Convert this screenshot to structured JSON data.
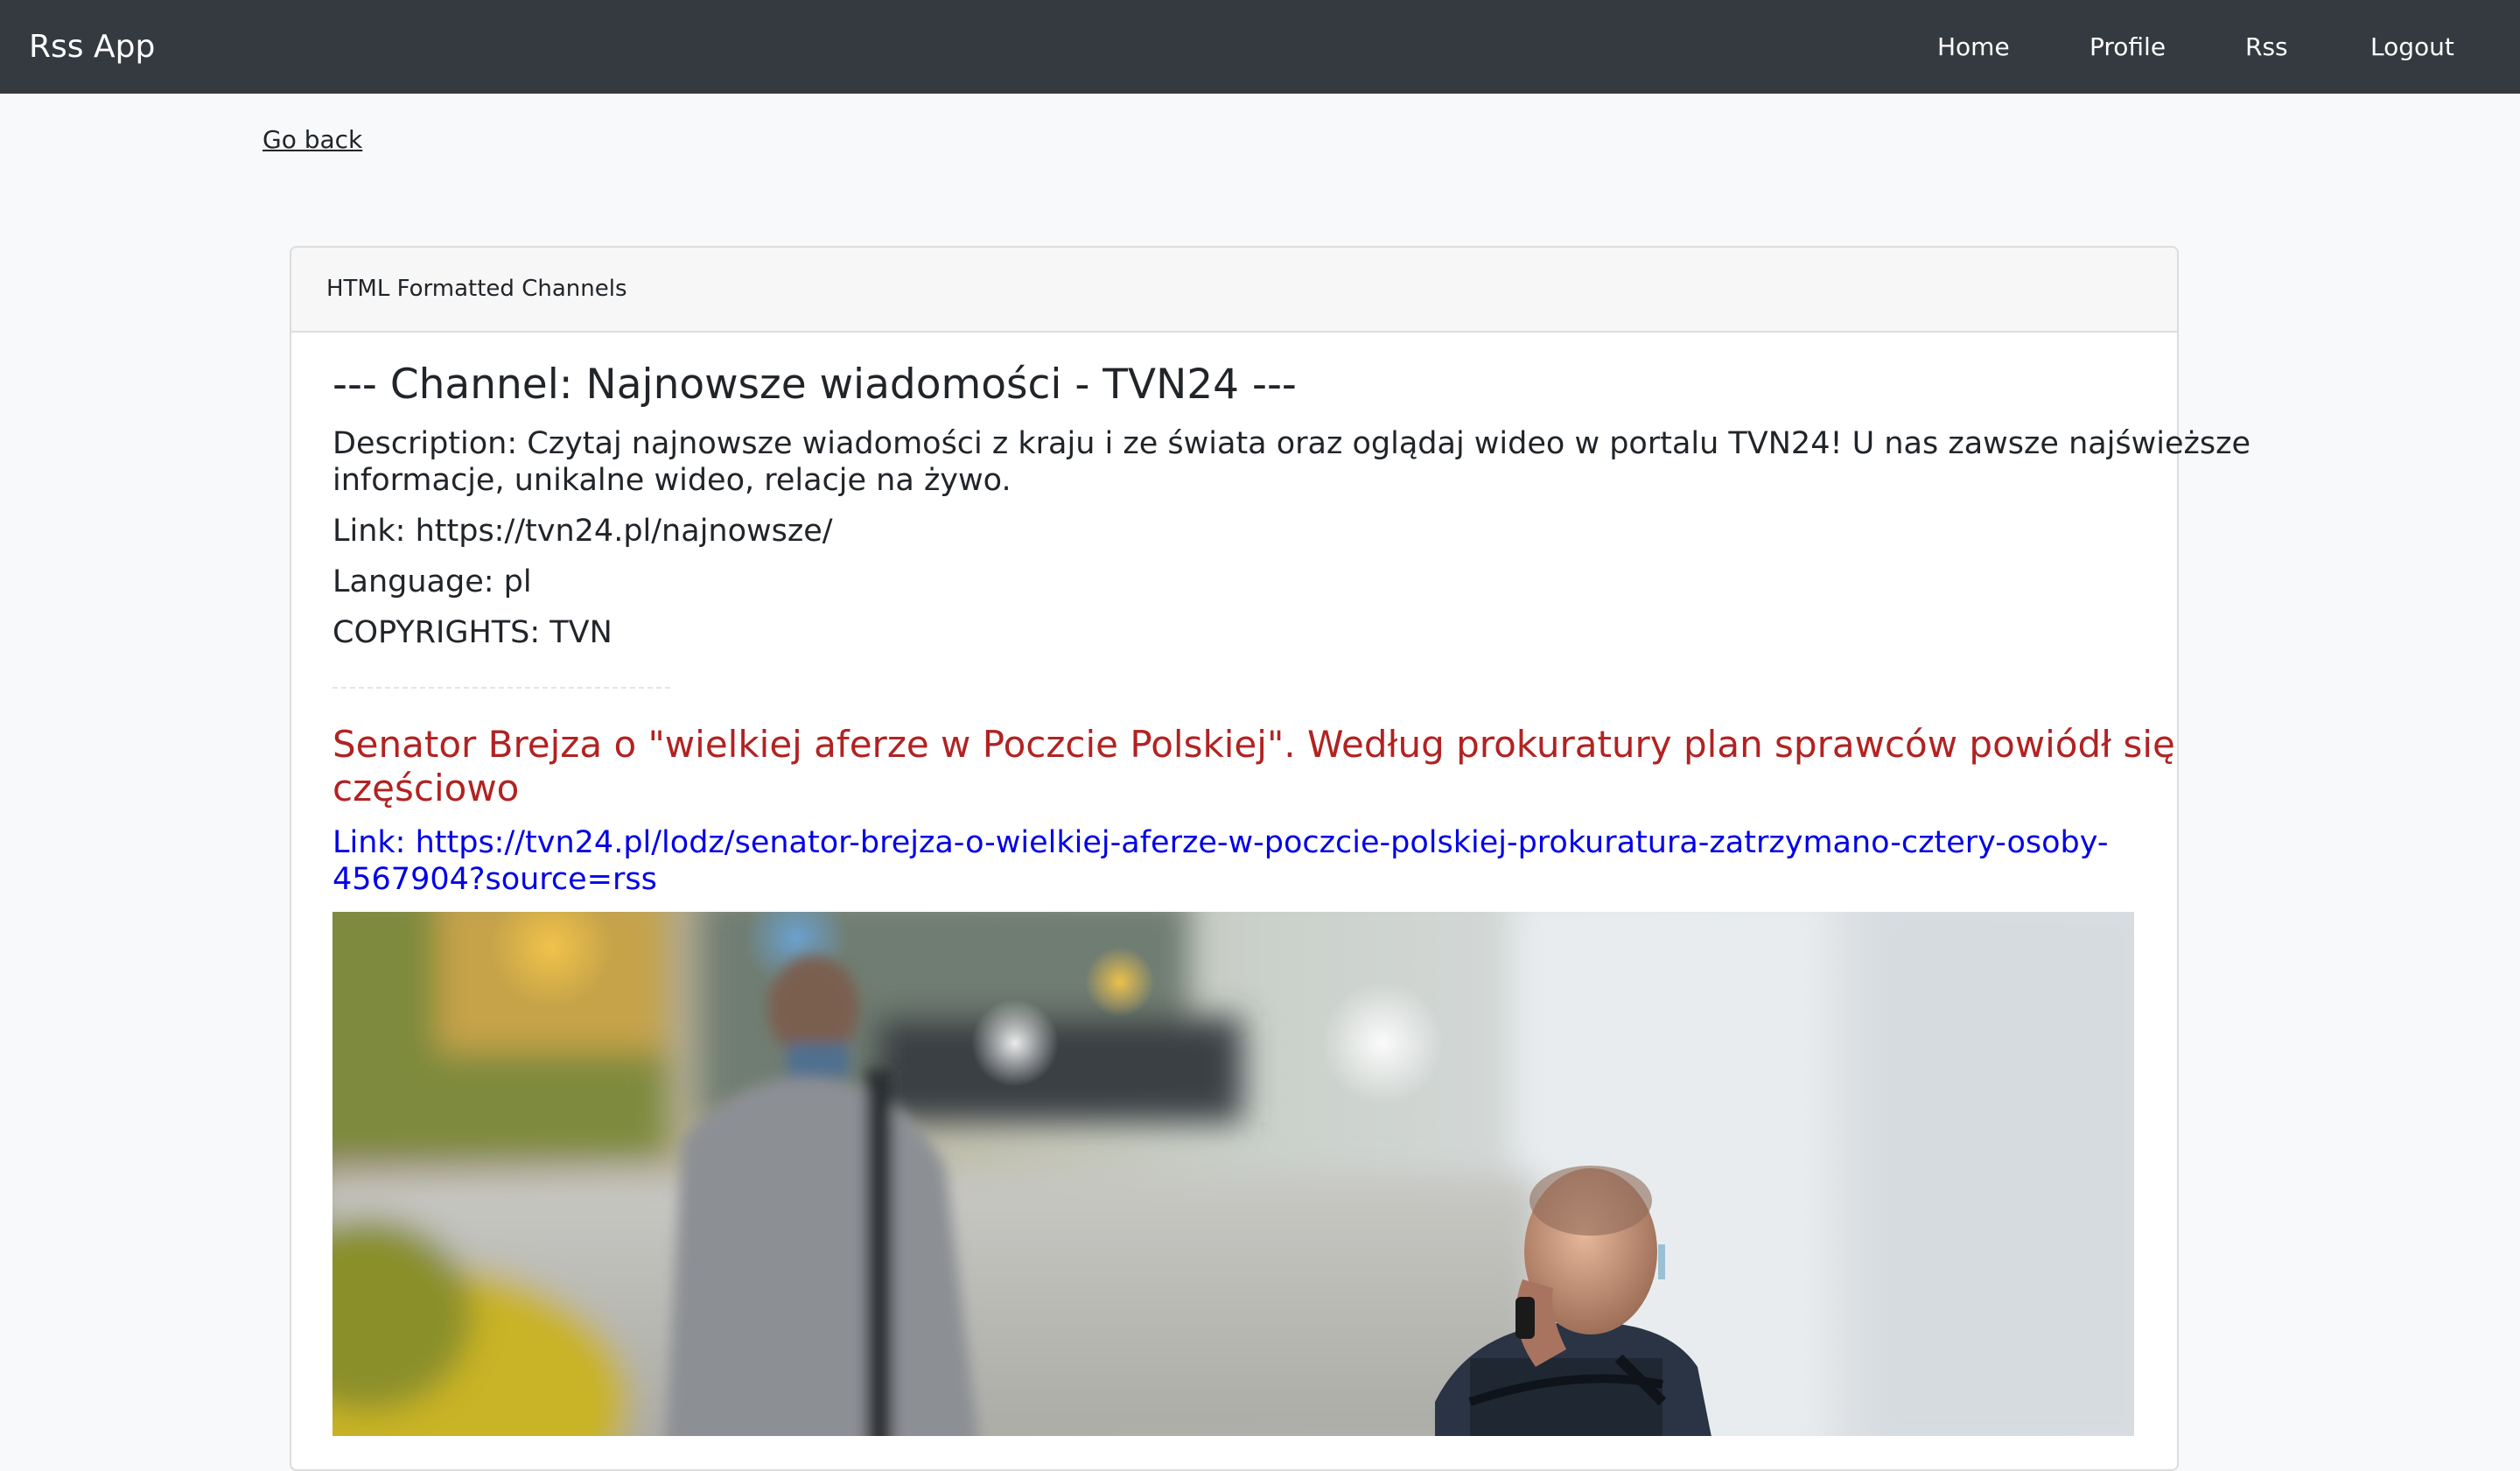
{
  "navbar": {
    "brand": "Rss App",
    "links": [
      {
        "label": "Home"
      },
      {
        "label": "Profile"
      },
      {
        "label": "Rss"
      },
      {
        "label": "Logout"
      }
    ]
  },
  "go_back": "Go back",
  "card": {
    "header": "HTML Formatted Channels",
    "channel": {
      "heading": "--- Channel: Najnowsze wiadomości - TVN24 ---",
      "description_line1": "Description: Czytaj najnowsze wiadomości z kraju i ze świata oraz oglądaj wideo w portalu TVN24! U nas zawsze najświeższe",
      "description_line2": "informacje, unikalne wideo, relacje na żywo.",
      "link": "Link: https://tvn24.pl/najnowsze/",
      "language": "Language: pl",
      "copyrights": "COPYRIGHTS: TVN"
    },
    "item": {
      "title_line1": "Senator Brejza o \"wielkiej aferze w Poczcie Polskiej\". Według prokuratury plan sprawców powiódł się",
      "title_line2": "częściowo",
      "link_line1": "Link: https://tvn24.pl/lodz/senator-brejza-o-wielkiej-aferze-w-poczcie-polskiej-prokuratura-zatrzymano-cztery-osoby-",
      "link_line2": "4567904?source=rss"
    }
  },
  "colors": {
    "navbar": "#343a40",
    "item_title": "#b22222",
    "item_link": "#0000e6"
  }
}
